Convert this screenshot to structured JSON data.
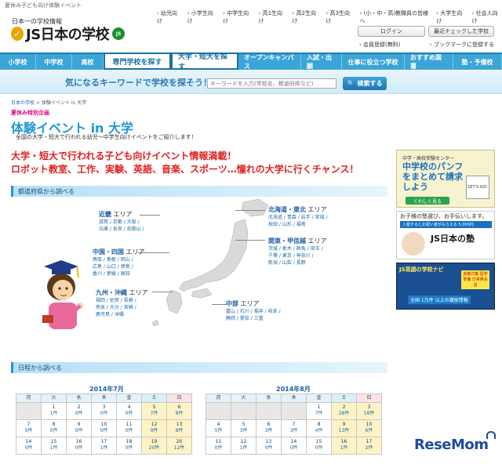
{
  "top_strip": "夏休み子ども向け体験イベント",
  "header": {
    "tagline": "日本一の学校情報",
    "logo": "JS日本の学校",
    "logo_badge": "JS",
    "links": [
      "幼児向け",
      "小学生向け",
      "中学生向け",
      "高1生向け",
      "高2生向け",
      "高3生向け",
      "(小・中・高)教職員の皆様へ",
      "大学生向け",
      "社会人向け"
    ],
    "login": "ログイン",
    "recent": "最近チェックした学校",
    "register": "会員登録(無料)",
    "bookmark": "ブックマークに登録する"
  },
  "nav": [
    "小学校",
    "中学校",
    "高校",
    "専門学校を探す",
    "大学・短大を探す",
    "オープンキャンパス",
    "入試・出願",
    "仕事に役立つ学校",
    "おすすめ図書",
    "塾・予備校"
  ],
  "search": {
    "label": "気になるキーワードで学校を探そう！",
    "placeholder": "キーワードを入力(学校名、都道府県など)",
    "button": "検索する"
  },
  "breadcrumb": {
    "home": "日本の学校",
    "current": "体験イベント in 大学"
  },
  "page": {
    "badge": "夏休み特別企画",
    "title": "体験イベント in 大学",
    "desc": "全国の大学・短大で行われる幼児〜中学生向けイベントをご紹介します！",
    "headline1": "大学・短大で行われる子ども向けイベント情報満載！",
    "headline2": "ロボット教室、工作、実験、英語、音楽、スポーツ…憧れの大学に行くチャンス！"
  },
  "sections": {
    "prefecture": "都道府県から調べる",
    "date": "日程から調べる"
  },
  "regions": [
    {
      "name": "近畿",
      "suffix": "エリア",
      "prefs": [
        "滋賀",
        "京都",
        "大阪",
        "兵庫",
        "奈良",
        "和歌山"
      ]
    },
    {
      "name": "中国・四国",
      "suffix": "エリア",
      "prefs": [
        "鳥取",
        "島根",
        "岡山",
        "広島",
        "山口",
        "徳島",
        "香川",
        "愛媛",
        "高知"
      ]
    },
    {
      "name": "九州・沖縄",
      "suffix": "エリア",
      "prefs": [
        "福岡",
        "佐賀",
        "長崎",
        "熊本",
        "大分",
        "宮崎",
        "鹿児島",
        "沖縄"
      ]
    },
    {
      "name": "北海道・東北",
      "suffix": "エリア",
      "prefs": [
        "北海道",
        "青森",
        "岩手",
        "宮城",
        "秋田",
        "山形",
        "福島"
      ]
    },
    {
      "name": "関東・甲信越",
      "suffix": "エリア",
      "prefs": [
        "茨城",
        "栃木",
        "群馬",
        "埼玉",
        "千葉",
        "東京",
        "神奈川",
        "新潟",
        "山梨",
        "長野"
      ]
    },
    {
      "name": "中部",
      "suffix": "エリア",
      "prefs": [
        "富山",
        "石川",
        "福井",
        "岐阜",
        "静岡",
        "愛知",
        "三重"
      ]
    }
  ],
  "sidebar": {
    "ad1_top": "中学・高校受験センター",
    "ad1_body": "中学校のパンフをまとめて請求しよう",
    "ad1_button": "くわしく見る",
    "ad1_go": "LET'S GO!",
    "ad2_top": "お子様の塾選び、お手伝いします。",
    "ad2_ribbon": "入塾するとお祝い金がもらえる 5,000円",
    "ad2_logo": "JS日本の塾",
    "ad3_top": "JS英語の学校ナビ",
    "ad3_sub": "全国 1万件 以上の講座情報",
    "ad3_tag": "資格対策 留学準備 日常英会話"
  },
  "calendars": [
    {
      "title": "2014年7月",
      "weekdays": [
        "月",
        "火",
        "水",
        "木",
        "金",
        "土",
        "日"
      ],
      "rows": [
        [
          {
            "d": "",
            "c": ""
          },
          {
            "d": "1",
            "c": "1件"
          },
          {
            "d": "2",
            "c": "0件"
          },
          {
            "d": "3",
            "c": "0件"
          },
          {
            "d": "4",
            "c": "0件"
          },
          {
            "d": "5",
            "c": "7件"
          },
          {
            "d": "6",
            "c": "8件"
          }
        ],
        [
          {
            "d": "7",
            "c": "0件"
          },
          {
            "d": "8",
            "c": "0件"
          },
          {
            "d": "9",
            "c": "0件"
          },
          {
            "d": "10",
            "c": "0件"
          },
          {
            "d": "11",
            "c": "0件"
          },
          {
            "d": "12",
            "c": "9件"
          },
          {
            "d": "13",
            "c": "8件"
          }
        ],
        [
          {
            "d": "14",
            "c": "0件"
          },
          {
            "d": "15",
            "c": "1件"
          },
          {
            "d": "16",
            "c": "0件"
          },
          {
            "d": "17",
            "c": "1件"
          },
          {
            "d": "18",
            "c": "0件"
          },
          {
            "d": "19",
            "c": "20件"
          },
          {
            "d": "20",
            "c": "12件"
          }
        ]
      ]
    },
    {
      "title": "2014年8月",
      "weekdays": [
        "月",
        "火",
        "水",
        "木",
        "金",
        "土",
        "日"
      ],
      "rows": [
        [
          {
            "d": "",
            "c": ""
          },
          {
            "d": "",
            "c": ""
          },
          {
            "d": "",
            "c": ""
          },
          {
            "d": "",
            "c": ""
          },
          {
            "d": "1",
            "c": "7件"
          },
          {
            "d": "2",
            "c": "28件"
          },
          {
            "d": "3",
            "c": "18件"
          }
        ],
        [
          {
            "d": "4",
            "c": "5件"
          },
          {
            "d": "5",
            "c": "3件"
          },
          {
            "d": "6",
            "c": "3件"
          },
          {
            "d": "7",
            "c": "3件"
          },
          {
            "d": "8",
            "c": "4件"
          },
          {
            "d": "9",
            "c": "13件"
          },
          {
            "d": "10",
            "c": "6件"
          }
        ],
        [
          {
            "d": "11",
            "c": "0件"
          },
          {
            "d": "12",
            "c": "1件"
          },
          {
            "d": "13",
            "c": "0件"
          },
          {
            "d": "14",
            "c": "0件"
          },
          {
            "d": "15",
            "c": "0件"
          },
          {
            "d": "16",
            "c": "1件"
          },
          {
            "d": "17",
            "c": "2件"
          }
        ]
      ]
    }
  ],
  "watermark": "ReseMom",
  "colors": {
    "nav": "#3ba5d8",
    "title": "#1f97d4",
    "red": "#e02020",
    "accent": "#e4007f"
  }
}
